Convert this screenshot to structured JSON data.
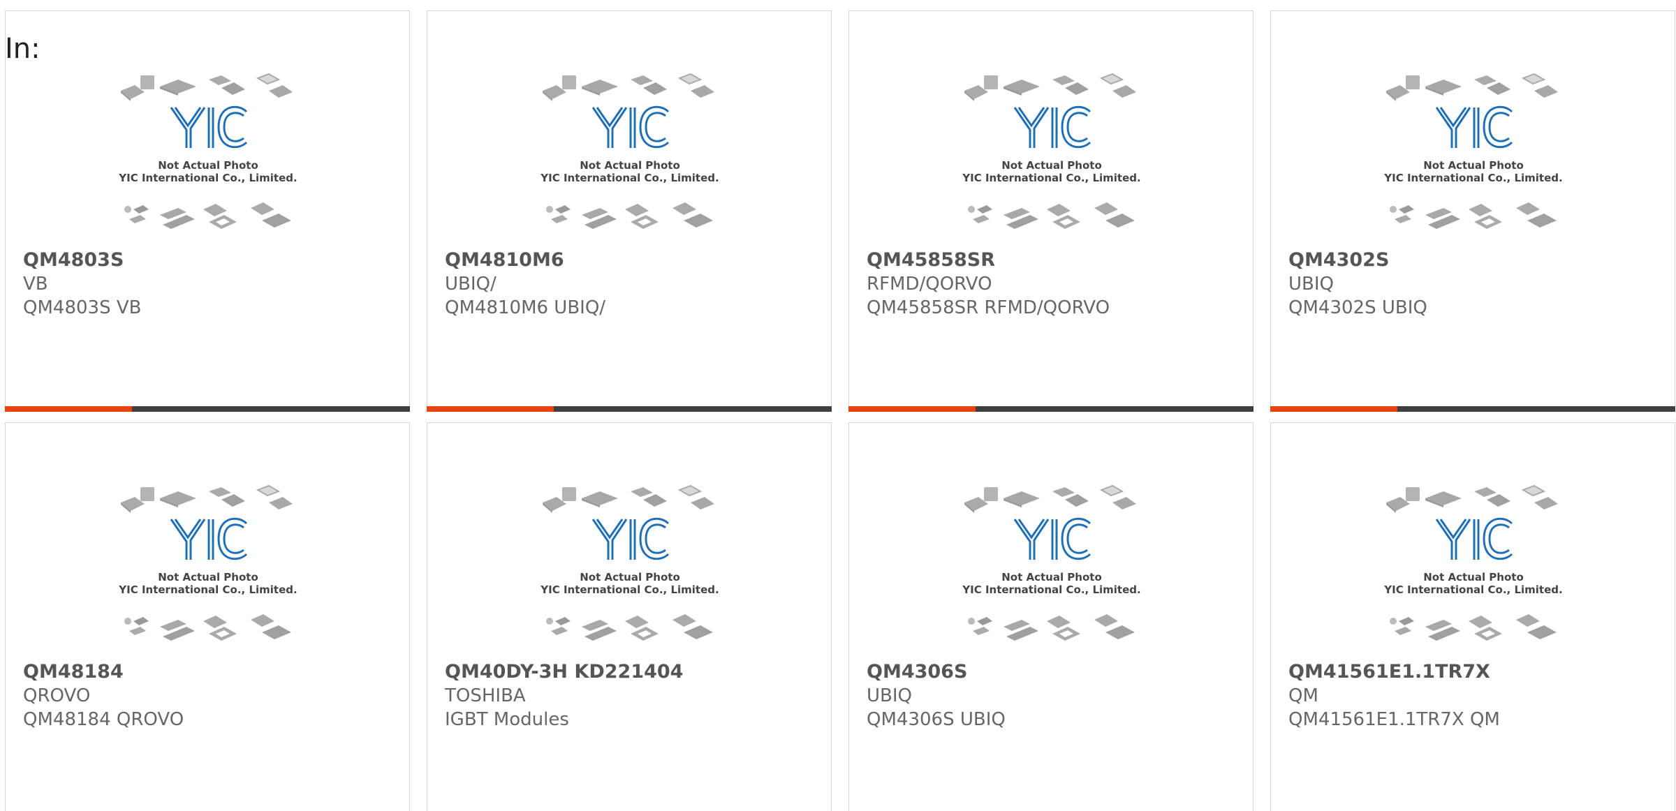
{
  "filter": {
    "in_label": "In:"
  },
  "placeholder_image": {
    "logo_text": "YIC",
    "caption_line1": "Not Actual Photo",
    "caption_line2": "YIC International Co., Limited.",
    "logo_color": "#1e6fb8"
  },
  "colors": {
    "accent_bar": "#e8430f",
    "dark_bar": "#3f3f3f"
  },
  "products": [
    {
      "part_number": "QM4803S",
      "manufacturer": "VB",
      "description": "QM4803S VB",
      "has_bar": true
    },
    {
      "part_number": "QM4810M6",
      "manufacturer": "UBIQ/",
      "description": "QM4810M6 UBIQ/",
      "has_bar": true
    },
    {
      "part_number": "QM45858SR",
      "manufacturer": "RFMD/QORVO",
      "description": "QM45858SR RFMD/QORVO",
      "has_bar": true
    },
    {
      "part_number": "QM4302S",
      "manufacturer": "UBIQ",
      "description": "QM4302S UBIQ",
      "has_bar": true
    },
    {
      "part_number": "QM48184",
      "manufacturer": "QROVO",
      "description": "QM48184 QROVO",
      "has_bar": false
    },
    {
      "part_number": "QM40DY-3H KD221404",
      "manufacturer": "TOSHIBA",
      "description": "IGBT Modules",
      "has_bar": false
    },
    {
      "part_number": "QM4306S",
      "manufacturer": "UBIQ",
      "description": "QM4306S UBIQ",
      "has_bar": false
    },
    {
      "part_number": "QM41561E1.1TR7X",
      "manufacturer": "QM",
      "description": "QM41561E1.1TR7X QM",
      "has_bar": false
    }
  ]
}
